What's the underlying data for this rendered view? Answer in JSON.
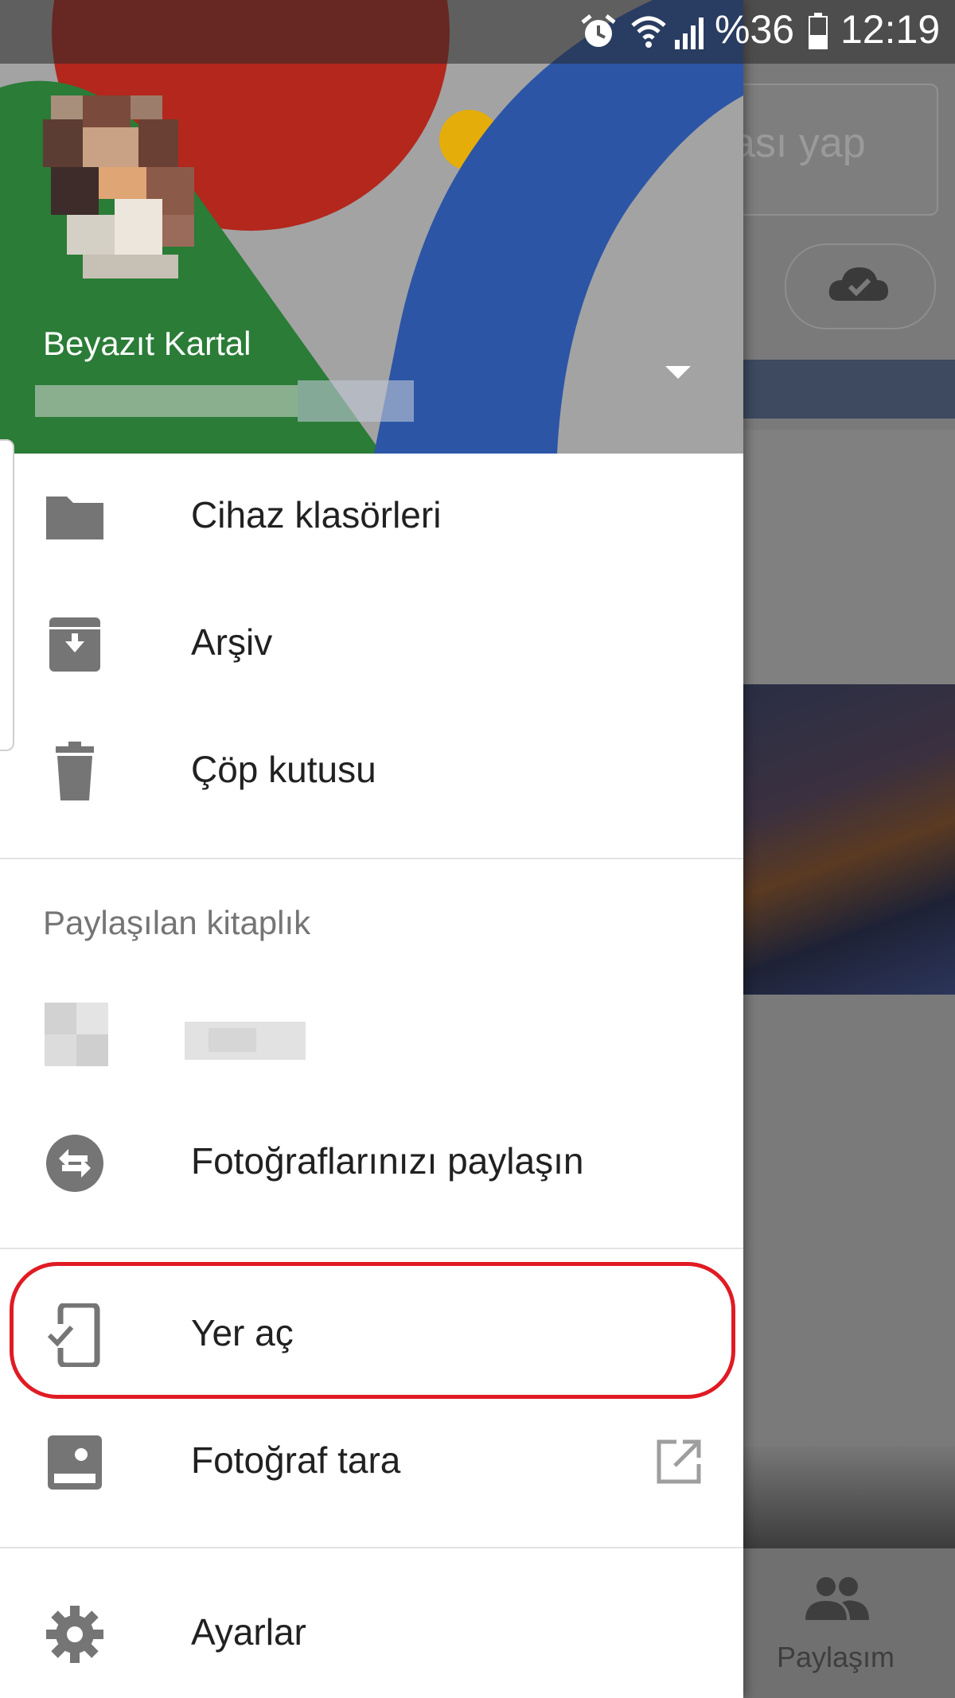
{
  "status_bar": {
    "battery": "%36",
    "time": "12:19",
    "icons": [
      "alarm-icon",
      "wifi-icon",
      "signal-icon",
      "battery-icon"
    ]
  },
  "account": {
    "name": "Beyazıt Kartal"
  },
  "drawer": {
    "items_top": [
      {
        "label": "Cihaz klasörleri",
        "icon": "folder-icon"
      },
      {
        "label": "Arşiv",
        "icon": "archive-icon"
      },
      {
        "label": "Çöp kutusu",
        "icon": "trash-icon"
      }
    ],
    "shared_section_title": "Paylaşılan kitaplık",
    "share_item": {
      "label": "Fotoğraflarınızı paylaşın",
      "icon": "share-swap-icon"
    },
    "free_space_item": {
      "label": "Yer aç",
      "icon": "phone-check-icon"
    },
    "scan_item": {
      "label": "Fotoğraf tara",
      "icon": "photoscan-icon",
      "trailing_icon": "open-external-icon"
    },
    "settings_item": {
      "label": "Ayarlar",
      "icon": "gear-icon"
    }
  },
  "background_app": {
    "search_fragment": "ası yap",
    "bottom_nav_label": "Paylaşım"
  },
  "colors": {
    "highlight": "#e01b24",
    "header_red": "#c0392b",
    "header_green": "#2e8b3e",
    "header_blue": "#2f5bb7",
    "header_yellow": "#f2b705"
  }
}
